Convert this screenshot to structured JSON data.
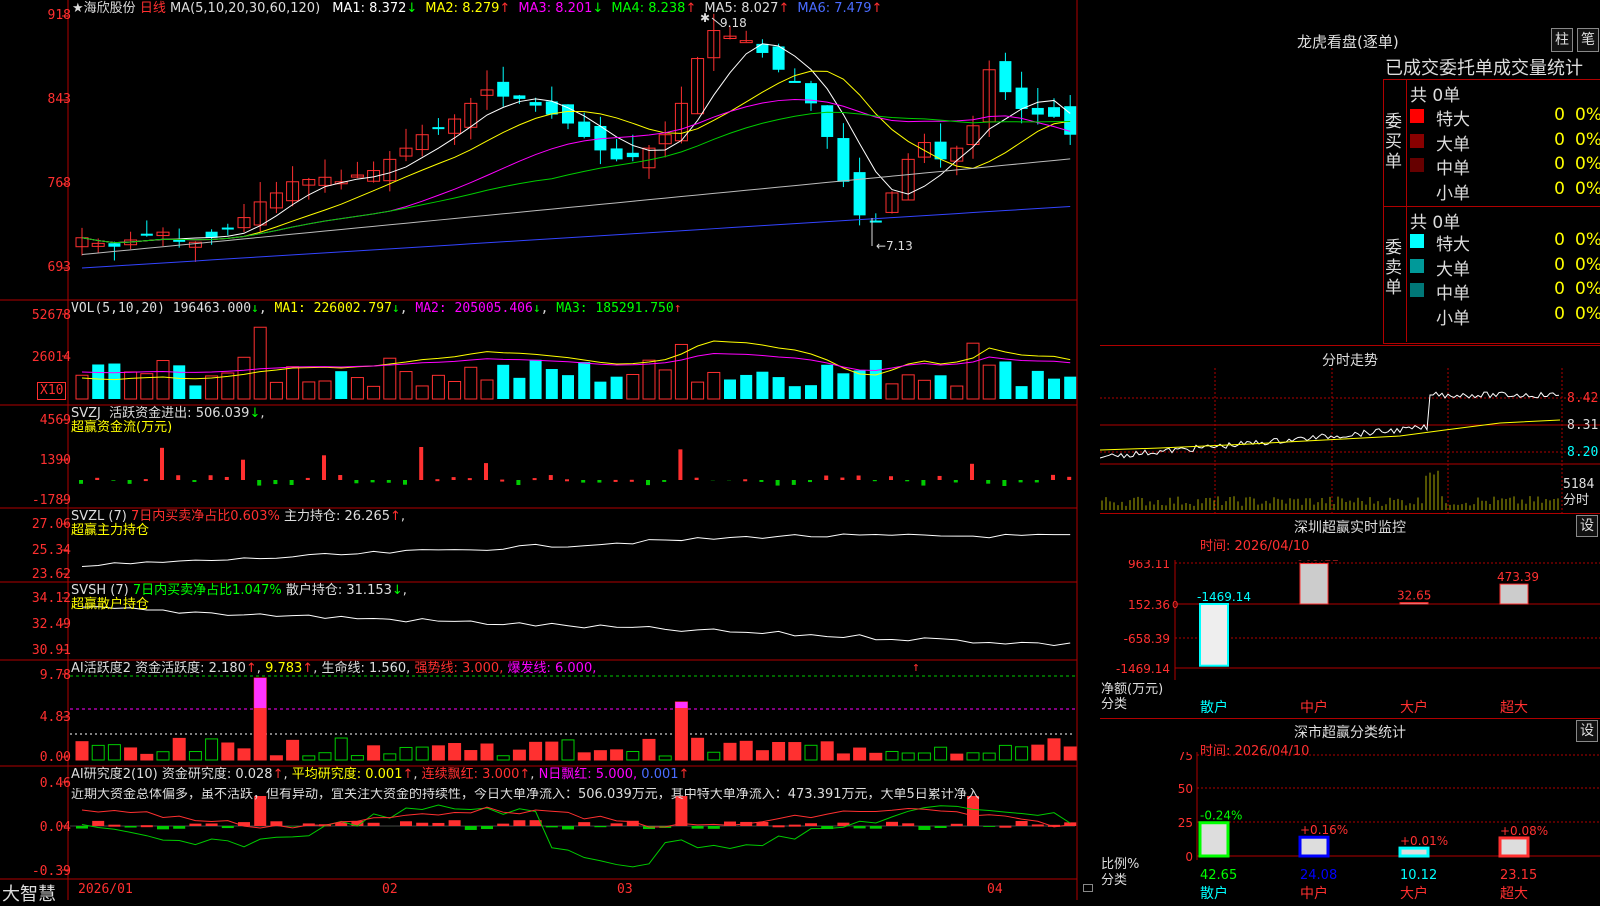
{
  "main": {
    "star": "★",
    "stock_name": "海欣股份",
    "period": "日线",
    "ma_params": "MA(5,10,20,30,60,120)",
    "ma": [
      {
        "label": "MA1:",
        "value": "8.372",
        "arrow": "↓",
        "color": "#ffffff"
      },
      {
        "label": "MA2:",
        "value": "8.279",
        "arrow": "↑",
        "color": "#ffff00"
      },
      {
        "label": "MA3:",
        "value": "8.201",
        "arrow": "↓",
        "color": "#ff00ff"
      },
      {
        "label": "MA4:",
        "value": "8.238",
        "arrow": "↑",
        "color": "#00ff00"
      },
      {
        "label": "MA5:",
        "value": "8.027",
        "arrow": "↑",
        "color": "#dddddd"
      },
      {
        "label": "MA6:",
        "value": "7.479",
        "arrow": "↑",
        "color": "#4a6cff"
      }
    ],
    "y_ticks": [
      "918",
      "843",
      "768",
      "693"
    ],
    "high_label": "9.18",
    "low_label": "←7.13",
    "close_marker": "7.13"
  },
  "vol": {
    "title": "VOL(5,10,20)",
    "value": "196463.000",
    "ma1": "MA1: 226002.797",
    "ma2": "MA2: 205005.406",
    "ma3": "MA3: 185291.750",
    "y_ticks": [
      "52678",
      "26014"
    ],
    "unit": "X10"
  },
  "svzj": {
    "title": "SVZJ",
    "name": "活跃资金进出:",
    "value": "506.039",
    "sub": "超赢资金流(万元)",
    "y_ticks": [
      "4569",
      "1390",
      "-1789"
    ]
  },
  "svzl": {
    "title": "SVZL (7)",
    "ratio": "7日内买卖净占比0.603%",
    "name": "主力持仓:",
    "value": "26.265",
    "sub": "超赢主力持仓",
    "y_ticks": [
      "27.06",
      "25.34",
      "23.62"
    ]
  },
  "svsh": {
    "title": "SVSH (7)",
    "ratio": "7日内买卖净占比1.047%",
    "name": "散户持仓:",
    "value": "31.153",
    "sub": "超赢散户持仓",
    "y_ticks": [
      "34.12",
      "32.49",
      "30.91"
    ]
  },
  "ai1": {
    "title": "AI活跃度2",
    "name": "资金活跃度:",
    "v1": "2.180",
    "v2": "9.783",
    "life": "生命线: 1.560,",
    "strong": "强势线: 3.000,",
    "burst": "爆发线: 6.000,",
    "y_ticks": [
      "9.78",
      "4.83",
      "0.00"
    ]
  },
  "ai2": {
    "title": "AI研究度2(10)",
    "name": "资金研究度:",
    "v1": "0.028",
    "avg": "平均研究度: 0.001",
    "lx": "连续飘红: 3.000",
    "nr": "N日飘红: 5.000,",
    "extra": "0.001",
    "comment": "近期大资金总体偏多，虽不活跃，但有异动，宜关注大资金的持续性，今日大单净流入：506.039万元，其中特大单净流入：473.391万元，大单5日累计净入",
    "y_ticks": [
      "0.46",
      "0.04",
      "-0.39"
    ]
  },
  "footer": {
    "brand": "大智慧",
    "dates": [
      "2026/01",
      "02",
      "03",
      "04"
    ]
  },
  "longhu": {
    "title": "龙虎看盘(逐单)",
    "btn1": "柱",
    "btn2": "笔",
    "subtitle": "已成交委托单成交量统计",
    "buy_label": "委买单",
    "sell_label": "委卖单",
    "buy_total": "共 0单",
    "sell_total": "共 0单",
    "buy_rows": [
      {
        "name": "特大",
        "count": "0",
        "pct": "0%",
        "color": "#ff0000"
      },
      {
        "name": "大单",
        "count": "0",
        "pct": "0%",
        "color": "#880000"
      },
      {
        "name": "中单",
        "count": "0",
        "pct": "0%",
        "color": "#660000"
      },
      {
        "name": "小单",
        "count": "0",
        "pct": "0%",
        "color": "#000000"
      }
    ],
    "sell_rows": [
      {
        "name": "特大",
        "count": "0",
        "pct": "0%",
        "color": "#00ffff"
      },
      {
        "name": "大单",
        "count": "0",
        "pct": "0%",
        "color": "#009999"
      },
      {
        "name": "中单",
        "count": "0",
        "pct": "0%",
        "color": "#007777"
      },
      {
        "name": "小单",
        "count": "0",
        "pct": "0%",
        "color": "#000000"
      }
    ]
  },
  "fenshi": {
    "title": "分时走势",
    "prices": [
      "8.42",
      "8.31",
      "8.20"
    ],
    "vol_top": "5184",
    "vol_unit": "分时"
  },
  "monitor": {
    "title": "深圳超赢实时监控",
    "btn": "设",
    "time": "时间: 2026/04/10",
    "y_ticks": [
      "963.11",
      "152.36",
      "-658.39",
      "-1469.14"
    ],
    "zero": "0",
    "unit": "净额(万元)",
    "cat_label": "分类",
    "cats": [
      "散户",
      "中户",
      "大户",
      "超大"
    ]
  },
  "classify": {
    "title": "深市超赢分类统计",
    "btn": "设",
    "time": "时间: 2026/04/10",
    "y_ticks": [
      "75",
      "50",
      "25",
      "0"
    ],
    "unit": "比例%",
    "cat_label": "分类",
    "cats": [
      "散户",
      "中户",
      "大户",
      "超大"
    ]
  },
  "chart_data": [
    {
      "type": "bar",
      "title": "深圳超赢实时监控",
      "categories": [
        "散户",
        "中户",
        "大户",
        "超大"
      ],
      "values": [
        -1469.14,
        963.11,
        32.65,
        473.39
      ],
      "labels": [
        "-1469.14",
        "963.11",
        "32.65",
        "473.39"
      ],
      "ylim": [
        -1469.14,
        963.11
      ],
      "ylabel": "净额(万元)",
      "xlabel": "分类"
    },
    {
      "type": "bar",
      "title": "深市超赢分类统计",
      "categories": [
        "散户",
        "中户",
        "大户",
        "超大"
      ],
      "values": [
        42.65,
        24.08,
        10.12,
        23.15
      ],
      "changes": [
        "-0.24%",
        "+0.16%",
        "+0.01%",
        "+0.08%"
      ],
      "bar_labels": [
        "42.65",
        "24.08",
        "10.12",
        "23.15"
      ],
      "ylim": [
        0,
        75
      ],
      "ylabel": "比例%",
      "xlabel": "分类"
    }
  ]
}
